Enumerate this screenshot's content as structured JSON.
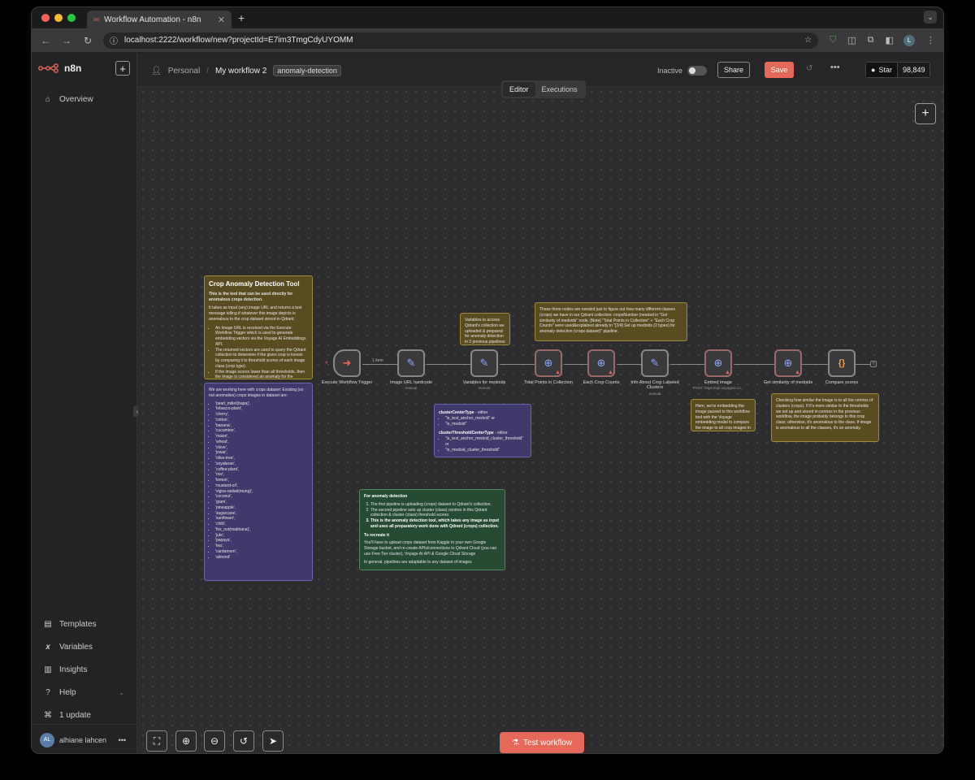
{
  "browser": {
    "tab_title": "Workflow Automation - n8n",
    "url": "localhost:2222/workflow/new?projectId=E7im3TmgCdyUYOMM",
    "profile_initial": "L"
  },
  "sidebar": {
    "logo_text": "n8n",
    "overview": "Overview",
    "templates": "Templates",
    "variables": "Variables",
    "insights": "Insights",
    "help": "Help",
    "update": "1 update",
    "user_name": "alhiane lahcen",
    "user_initials": "AL"
  },
  "header": {
    "project": "Personal",
    "workflow_name": "My workflow 2",
    "tag": "anomaly-detection",
    "status": "Inactive",
    "share": "Share",
    "save": "Save",
    "github_star": "Star",
    "github_count": "98,849"
  },
  "modes": {
    "editor": "Editor",
    "executions": "Executions"
  },
  "notes": {
    "main_title": "Crop Anomaly Detection Tool",
    "main_sub": "This is the tool that can be used directly for anomalous crops detection.",
    "main_p1": "It takes as input (any) image URL and returns a text message telling if whatever this image depicts is anomalous to the crop dataset stored in Qdrant.",
    "main_b1": "An Image URL is received via the Execute Workflow Trigger which is used to generate embedding vectors via the Voyage AI Embeddings API.",
    "main_b2": "The returned vectors are used to query the Qdrant collection to determine if the given crop is known by comparing it to threshold scores of each image class (crop type).",
    "main_b3": "If the image scores lower than all thresholds, then the image is considered an anomaly for the dataset.",
    "dataset_head": "We are working here with crops dataset: Existing (so not anomalies) crops images in dataset are:",
    "dataset_items": [
      "'pearl_millet(bajra)',",
      "'tobacco-plant',",
      "'cherry',",
      "'cotton',",
      "'banana',",
      "'cucumber',",
      "'maize',",
      "'wheat',",
      "'clove',",
      "'jowar',",
      "'olive-tree',",
      "'soyabean',",
      "'coffee-plant',",
      "'rice',",
      "'lemon',",
      "'mustard-oil',",
      "'vigna-radiati(mung)',",
      "'coconut',",
      "'gram',",
      "'pineapple',",
      "'sugarcane',",
      "'sunflower',",
      "'chilli',",
      "'fox_nut(makhana)',",
      "'jute',",
      "'papaya',",
      "'tea',",
      "'cardamom',",
      "'almond'"
    ],
    "vars_note": "Variables to access Qdrant's collection we uploaded & prepared for anomaly detection in 2 previous pipelines",
    "count_note": "These three nodes are needed just to figure out how many different classes (crops) we have in our Qdrant collection: cropsNumber (needed in \"Get similarity of medoids\" node. [Note] \"Total Points in Collection\" + \"Each Crop Counts\" were used&explained already in \"[2/4] Set up medoids (2 types) for anomaly detection (crops dataset)\" pipeline.",
    "center_title": "clusterCenterType",
    "center_either": " - either",
    "center_opt1": "\"is_text_anchor_medoid\" or",
    "center_opt2": "\"is_medoid\"",
    "thresh_title": "clusterThresholdCenterType",
    "thresh_either": " - either",
    "thresh_opt1": "\"is_text_anchor_medoid_cluster_threshold\" or",
    "thresh_opt2": "\"is_medoid_cluster_threshold\"",
    "embed_note": "Here, we're embedding the image passed to this workflow tool with the Voyage embedding model to compare the image to all crop images in the database.",
    "sim_note": "Checking how similar the image is to all the centres of clusters (crops). If it's more similar to the thresholds we set up and stored in-centres in the previous workflow, the image probably belongs to this crop class; otherwise, it's anomalous to the class. If image is anomalous to all the classes, it's an anomaly.",
    "anom_title": "For anomaly detection",
    "anom_1": "The first pipeline is uploading (crops) dataset to Qdrant's collection.",
    "anom_2": "The second pipeline sets up cluster (class) centres in this Qdrant collection & cluster (class) threshold scores.",
    "anom_3": "This is the anomaly detection tool, which takes any image as input and uses all preparatory work done with Qdrant (crops) collection.",
    "recreate_title": "To recreate it",
    "recreate_p1": "You'll have to upload crops dataset from Kaggle to your own Google Storage bucket, and re-create APIs/connections to Qdrant Cloud (you can use Free Tier cluster), Voyage AI API & Google Cloud Storage",
    "recreate_p2": "In general, pipelines are adaptable to any dataset of images"
  },
  "nodes": [
    {
      "label": "Execute Workflow Trigger",
      "sub": ""
    },
    {
      "label": "Image URL hardcode",
      "sub": "manual"
    },
    {
      "label": "Variables for medoids",
      "sub": "manual"
    },
    {
      "label": "Total Points in Collection",
      "sub": ""
    },
    {
      "label": "Each Crop Counts",
      "sub": ""
    },
    {
      "label": "Info About Crop Labeled Clusters",
      "sub": "manual"
    },
    {
      "label": "Embed image",
      "sub": "POST: https://api.voyageai.co..."
    },
    {
      "label": "Get similarity of medoids",
      "sub": ""
    },
    {
      "label": "Compare scores",
      "sub": ""
    }
  ],
  "connection_label": "1 item",
  "controls": {
    "test_workflow": "Test workflow"
  }
}
